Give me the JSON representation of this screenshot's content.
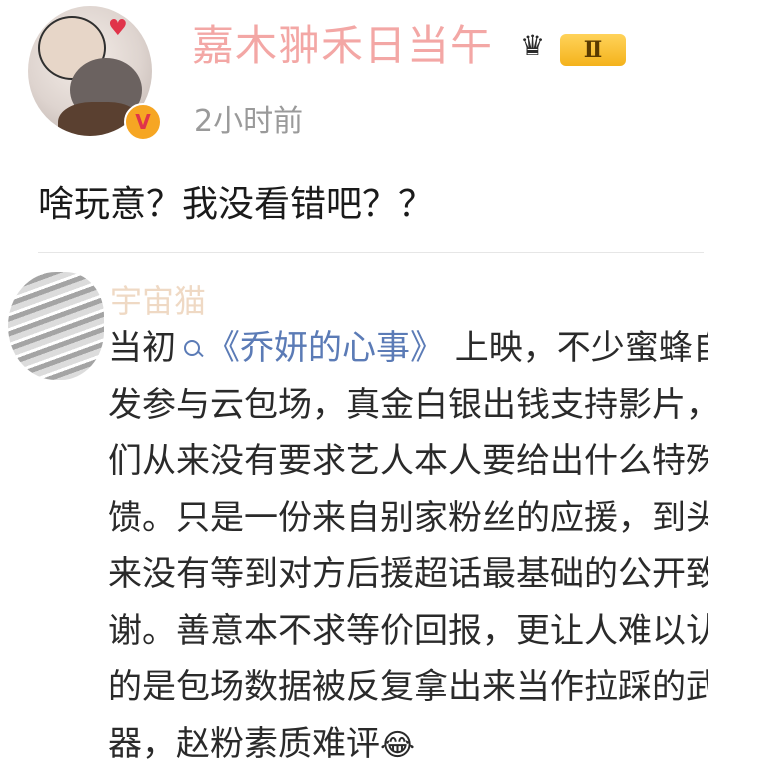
{
  "post": {
    "username": "嘉木翀禾日当午",
    "level_badge": "Ⅱ",
    "verified_badge": "V",
    "time": "2小时前",
    "text": "啥玩意？我没看错吧？？"
  },
  "quoted": {
    "name": "宇宙猫",
    "lines": [
      {
        "before": "当初",
        "link": "《乔妍的心事》",
        "after": " 上映，不少蜜蜂自"
      },
      {
        "text": "发参与云包场，真金白银出钱支持影片，"
      },
      {
        "text": "们从来没有要求艺人本人要给出什么特殊"
      },
      {
        "text": "馈。只是一份来自别家粉丝的应援，到头"
      },
      {
        "text": "来没有等到对方后援超话最基础的公开致"
      },
      {
        "text": "谢。善意本不求等价回报，更让人难以认"
      },
      {
        "text": "的是包场数据被反复拿出来当作拉踩的武"
      },
      {
        "text": "器，赵粉素质难评",
        "emoji": "😂"
      }
    ]
  },
  "colors": {
    "link": "#5b7bb6",
    "time": "#9a9a9a",
    "username": "#f08a88"
  }
}
